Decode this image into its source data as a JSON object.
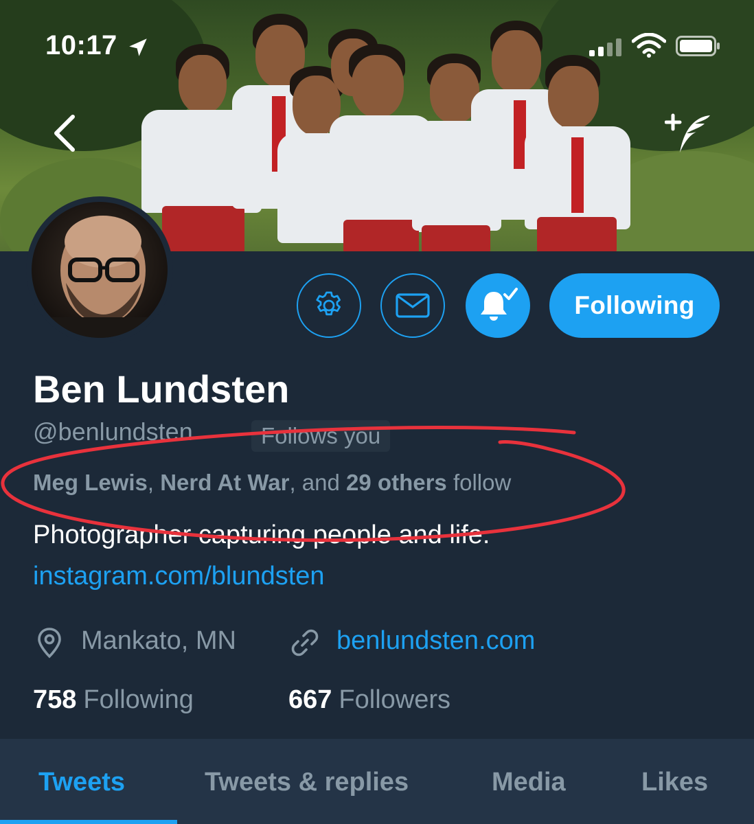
{
  "status_bar": {
    "time": "10:17",
    "icons": [
      "location-arrow-icon",
      "cellular-signal-icon",
      "wifi-icon",
      "battery-icon"
    ]
  },
  "header": {
    "back_icon": "chevron-left-icon",
    "compose_icon": "add-tweet-feather-icon"
  },
  "actions": {
    "settings_icon": "gear-icon",
    "message_icon": "envelope-icon",
    "notifications_icon": "bell-check-icon",
    "follow_button_label": "Following"
  },
  "profile": {
    "name": "Ben Lundsten",
    "handle": "@benlundsten",
    "follows_you_badge": "Follows you",
    "mutuals": {
      "name_1": "Meg Lewis",
      "separator": ",",
      "name_2": "Nerd At War",
      "and_text": ", and",
      "others_count": "29 others",
      "suffix": "follow"
    },
    "bio": "Photographer capturing people and life.",
    "bio_link": "instagram.com/blundsten",
    "location": "Mankato, MN",
    "website": "benlundsten.com",
    "following_count": "758",
    "following_label": "Following",
    "followers_count": "667",
    "followers_label": "Followers"
  },
  "tabs": [
    {
      "label": "Tweets",
      "active": true
    },
    {
      "label": "Tweets & replies",
      "active": false
    },
    {
      "label": "Media",
      "active": false
    },
    {
      "label": "Likes",
      "active": false
    }
  ],
  "colors": {
    "background": "#1c2938",
    "tab_background": "#243447",
    "accent": "#1da1f2",
    "secondary_text": "#8899a6",
    "annotation": "#e8323c"
  }
}
